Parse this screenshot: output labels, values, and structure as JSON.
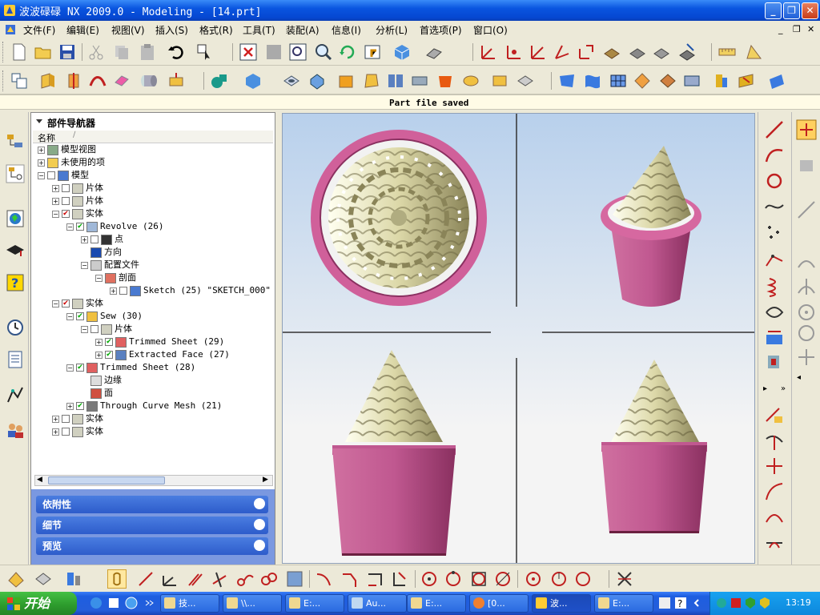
{
  "window": {
    "title": "波波碌碌 NX 2009.0 - Modeling - [14.prt]"
  },
  "menu": [
    "文件(F)",
    "编辑(E)",
    "视图(V)",
    "插入(S)",
    "格式(R)",
    "工具(T)",
    "装配(A)",
    "信息(I)",
    "分析(L)",
    "首选项(P)",
    "窗口(O)"
  ],
  "status": {
    "message": "Part file saved"
  },
  "navigator": {
    "title": "部件导航器",
    "column_name": "名称",
    "tree": [
      {
        "label": "模型视图",
        "indent": 0
      },
      {
        "label": "未使用的项",
        "indent": 0
      },
      {
        "label": "模型",
        "indent": 0
      },
      {
        "label": "片体",
        "indent": 1
      },
      {
        "label": "片体",
        "indent": 1
      },
      {
        "label": "实体",
        "indent": 1
      },
      {
        "label": "Revolve (26)",
        "indent": 2
      },
      {
        "label": "点",
        "indent": 3
      },
      {
        "label": "方向",
        "indent": 3
      },
      {
        "label": "配置文件",
        "indent": 3
      },
      {
        "label": "剖面",
        "indent": 4
      },
      {
        "label": "Sketch (25) \"SKETCH_000\"",
        "indent": 5
      },
      {
        "label": "实体",
        "indent": 1
      },
      {
        "label": "Sew (30)",
        "indent": 2
      },
      {
        "label": "片体",
        "indent": 3
      },
      {
        "label": "Trimmed Sheet (29)",
        "indent": 4
      },
      {
        "label": "Extracted Face (27)",
        "indent": 4
      },
      {
        "label": "Trimmed Sheet (28)",
        "indent": 2
      },
      {
        "label": "边缘",
        "indent": 3
      },
      {
        "label": "面",
        "indent": 3
      },
      {
        "label": "Through Curve Mesh (21)",
        "indent": 2
      },
      {
        "label": "实体",
        "indent": 1
      },
      {
        "label": "实体",
        "indent": 1
      }
    ],
    "panels": [
      "依附性",
      "细节",
      "预览"
    ]
  },
  "taskbar": {
    "start_label": "开始",
    "buttons": [
      "技...",
      "\\\\...",
      "E:...",
      "Au...",
      "E:...",
      "[0...",
      "波...",
      "E:..."
    ],
    "clock": "13:19"
  },
  "colors": {
    "cup_pink": "#c8588c",
    "cream": "#e8e6c4",
    "titlebar_blue": "#0a55e0"
  }
}
